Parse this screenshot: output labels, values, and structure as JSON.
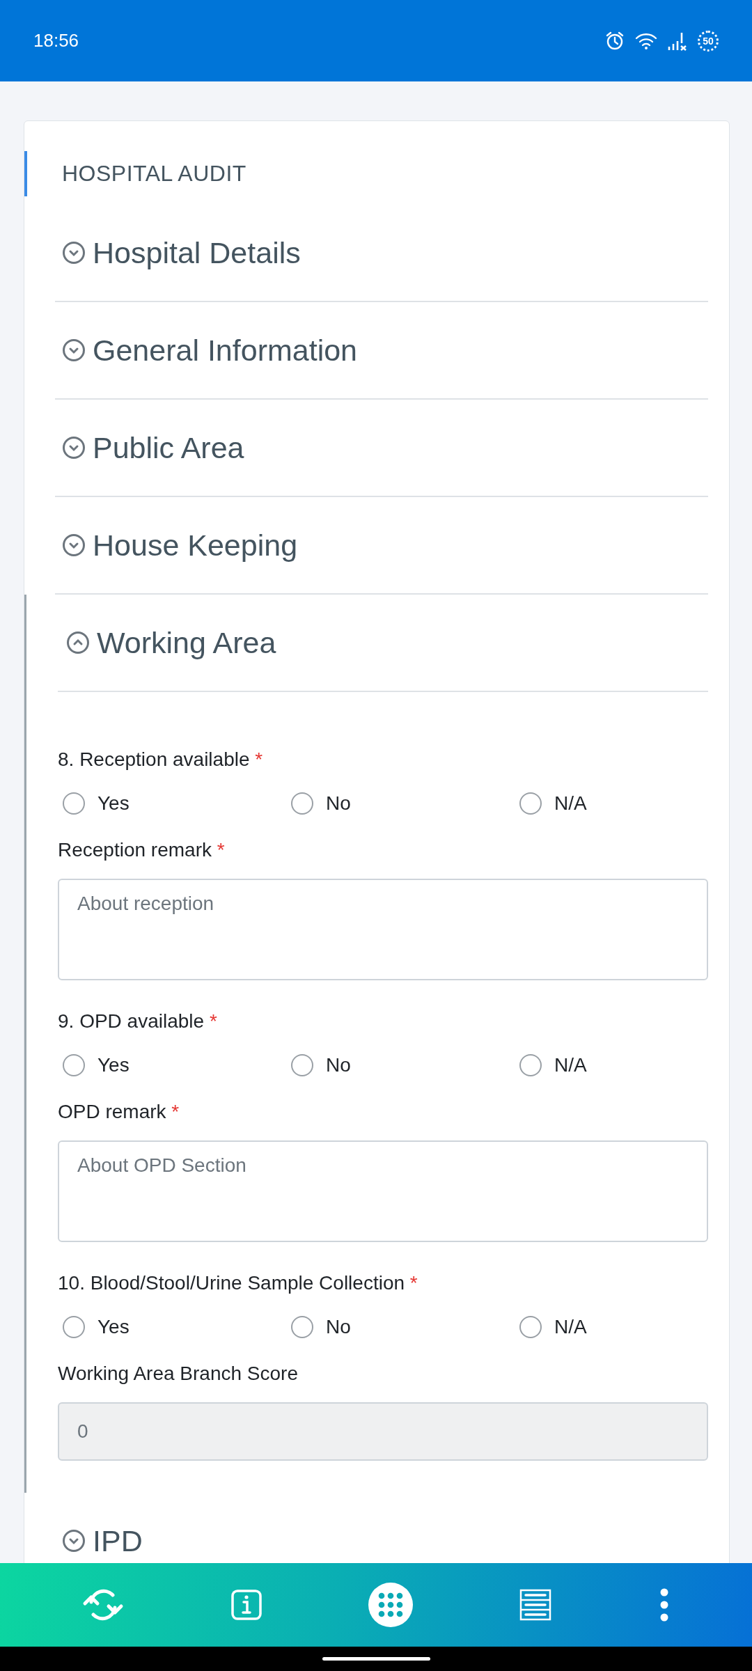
{
  "status_bar": {
    "time": "18:56",
    "battery": "50"
  },
  "form": {
    "title": "HOSPITAL AUDIT",
    "sections": [
      {
        "title": "Hospital Details",
        "expanded": false
      },
      {
        "title": "General Information",
        "expanded": false
      },
      {
        "title": "Public Area",
        "expanded": false
      },
      {
        "title": "House Keeping",
        "expanded": false
      },
      {
        "title": "Working Area",
        "expanded": true,
        "fields": [
          {
            "kind": "radio",
            "label": "8. Reception available",
            "required_mark": "*",
            "options": [
              {
                "label": "Yes",
                "selected": false
              },
              {
                "label": "No",
                "selected": false
              },
              {
                "label": "N/A",
                "selected": false
              }
            ]
          },
          {
            "kind": "textarea",
            "label": "Reception remark",
            "required_mark": "*",
            "placeholder": "About reception"
          },
          {
            "kind": "radio",
            "label": "9. OPD available",
            "required_mark": "*",
            "options": [
              {
                "label": "Yes",
                "selected": false
              },
              {
                "label": "No",
                "selected": false
              },
              {
                "label": "N/A",
                "selected": false
              }
            ]
          },
          {
            "kind": "textarea",
            "label": "OPD remark",
            "required_mark": "*",
            "placeholder": "About OPD Section"
          },
          {
            "kind": "radio",
            "label": "10. Blood/Stool/Urine Sample Collection",
            "required_mark": "*",
            "options": [
              {
                "label": "Yes",
                "selected": false
              },
              {
                "label": "No",
                "selected": false
              },
              {
                "label": "N/A",
                "selected": false
              }
            ]
          },
          {
            "kind": "score",
            "label": "Working Area Branch Score",
            "value": "0"
          }
        ]
      },
      {
        "title": "IPD",
        "expanded": false
      }
    ]
  }
}
